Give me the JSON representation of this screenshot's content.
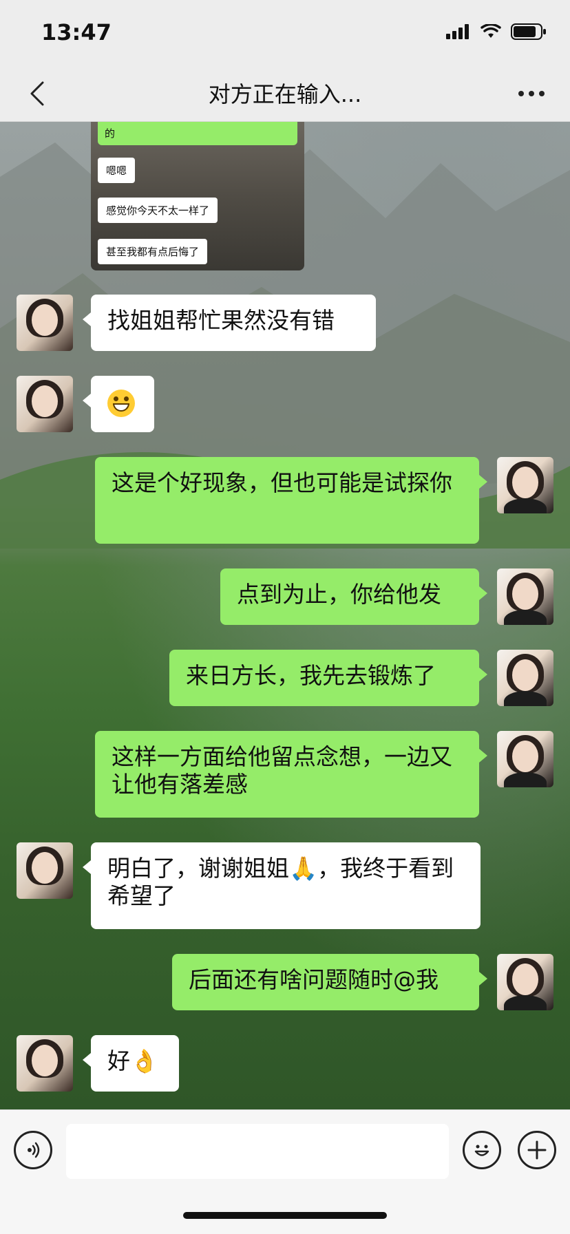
{
  "status_bar": {
    "time": "13:47"
  },
  "nav": {
    "title": "对方正在输入..."
  },
  "shared_image": {
    "top_text": "的",
    "bubbles": [
      "嗯嗯",
      "感觉你今天不太一样了",
      "甚至我都有点后悔了"
    ]
  },
  "messages": [
    {
      "side": "left",
      "text": "找姐姐帮忙果然没有错"
    },
    {
      "side": "left",
      "text": "",
      "emoji": "grin-icon"
    },
    {
      "side": "right",
      "text": "这是个好现象，但也可能是试探你"
    },
    {
      "side": "right",
      "text": "点到为止，你给他发"
    },
    {
      "side": "right",
      "text": "来日方长，我先去锻炼了"
    },
    {
      "side": "right",
      "text": "这样一方面给他留点念想，一边又让他有落差感"
    },
    {
      "side": "left",
      "text": "明白了，谢谢姐姐🙏，我终于看到希望了"
    },
    {
      "side": "right",
      "text": "后面还有啥问题随时@我"
    },
    {
      "side": "left",
      "text": "好👌"
    }
  ],
  "input": {
    "placeholder": ""
  }
}
